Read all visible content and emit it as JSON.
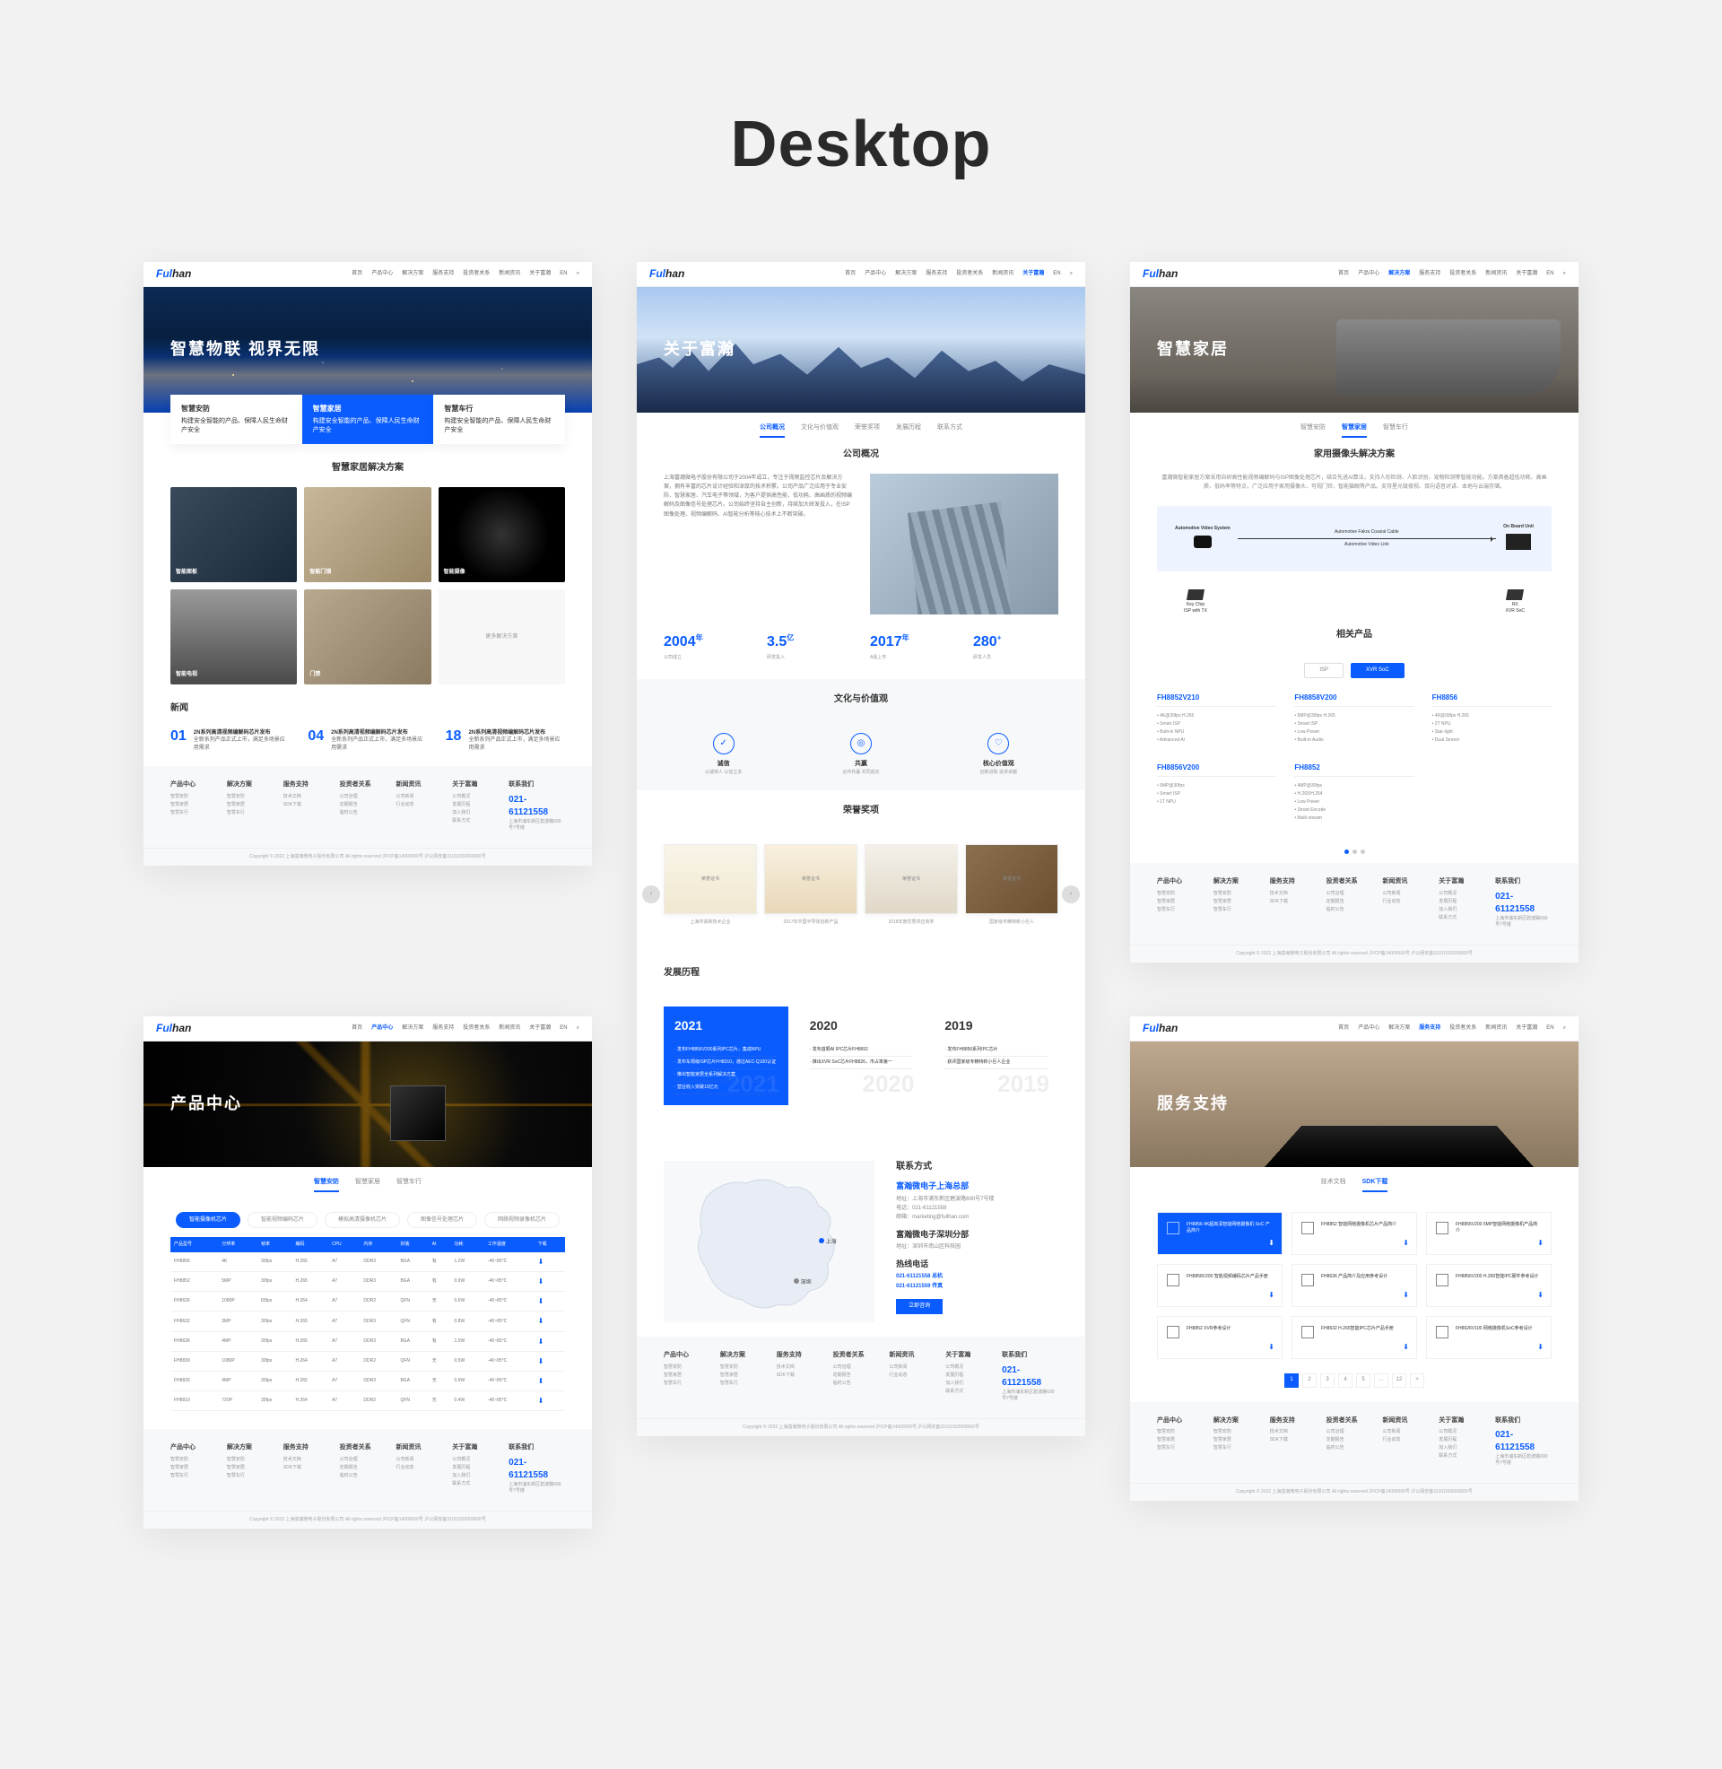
{
  "main_title": "Desktop",
  "brand": {
    "fu": "Ful",
    "han": "han"
  },
  "nav": {
    "items": [
      "首页",
      "产品中心",
      "解决方案",
      "服务支持",
      "投资者关系",
      "新闻资讯",
      "关于富瀚",
      "EN"
    ]
  },
  "footer": {
    "cols": [
      {
        "h": "产品中心",
        "items": [
          "智慧安防",
          "智慧家居",
          "智慧车行"
        ]
      },
      {
        "h": "解决方案",
        "items": [
          "智慧安防",
          "智慧家居",
          "智慧车行"
        ]
      },
      {
        "h": "服务支持",
        "items": [
          "技术文档",
          "SDK下载"
        ]
      },
      {
        "h": "投资者关系",
        "items": [
          "公司治理",
          "定期报告",
          "临时公告"
        ]
      },
      {
        "h": "新闻资讯",
        "items": [
          "公司新闻",
          "行业动态"
        ]
      },
      {
        "h": "关于富瀚",
        "items": [
          "公司概况",
          "发展历程",
          "加入我们",
          "联系方式"
        ]
      }
    ],
    "contact": {
      "h": "联系我们",
      "tel": "021-61121558",
      "addr": "上海市浦东新区碧波路690号7号楼"
    },
    "copy": "Copyright © 2022 上海富瀚微电子股份有限公司 All rights reserved   沪ICP备14000000号   沪公网安备31011502000000号"
  },
  "m1": {
    "hero": {
      "title": "智慧物联  视界无限"
    },
    "tabs": [
      {
        "t": "智慧安防",
        "d": "构建安全智能的产品、保障人民生命财产安全"
      },
      {
        "t": "智慧家居",
        "d": "构建安全智能的产品、保障人民生命财产安全"
      },
      {
        "t": "智慧车行",
        "d": "构建安全智能的产品、保障人民生命财产安全"
      }
    ],
    "section_title": "智慧家居解决方案",
    "thumbs": [
      "智能面板",
      "智能门锁",
      "智能摄像",
      "智能电视",
      "门禁",
      "更多解决方案"
    ],
    "news_title": "新闻",
    "news": [
      {
        "d": "01",
        "t": "2N系列高清视频编解码芯片发布",
        "s": "全新系列产品正式上市，满足多场景应用需求"
      },
      {
        "d": "04",
        "t": "2N系列高清视频编解码芯片发布",
        "s": "全新系列产品正式上市，满足多场景应用需求"
      },
      {
        "d": "18",
        "t": "2N系列高清视频编解码芯片发布",
        "s": "全新系列产品正式上市，满足多场景应用需求"
      }
    ]
  },
  "m2": {
    "hero": {
      "title": "关于富瀚"
    },
    "subnav": [
      "公司概况",
      "文化与价值观",
      "荣誉奖项",
      "发展历程",
      "联系方式"
    ],
    "overview": {
      "title": "公司概况",
      "body": "上海富瀚微电子股份有限公司于2004年成立，专注于视频监控芯片及解决方案，拥有丰富的芯片设计经验和深厚的技术积累。公司产品广泛应用于专业安防、智慧家居、汽车电子等领域，为客户提供高性能、低功耗、高画质的视频编解码及图像信号处理芯片。公司始终坚持自主创新，持续加大研发投入，在ISP图像处理、视频编解码、AI智能分析等核心技术上不断突破。"
    },
    "stats": [
      {
        "n": "2004",
        "l": "公司成立"
      },
      {
        "n": "3.5",
        "sup": "亿",
        "l": "研发投入"
      },
      {
        "n": "2017",
        "l": "A股上市"
      },
      {
        "n": "280",
        "sup": "+",
        "l": "研发人员"
      }
    ],
    "values": {
      "title": "文化与价值观",
      "items": [
        {
          "ic": "✓",
          "t": "诚信",
          "d": "以诚待人 以信立本"
        },
        {
          "ic": "◎",
          "t": "共赢",
          "d": "合作共赢 共同成长"
        },
        {
          "ic": "♡",
          "t": "核心价值观",
          "d": "创新进取 追求卓越"
        }
      ]
    },
    "awards": {
      "title": "荣誉奖项",
      "items": [
        "荣誉证书",
        "荣誉证书",
        "荣誉证书",
        "荣誉证书"
      ],
      "captions": [
        "上海市高新技术企业",
        "2017年中国半导体创新产品",
        "2018年度优秀供应商奖",
        "国家级专精特新小巨人"
      ]
    },
    "history": {
      "title": "发展历程",
      "years": [
        {
          "y": "2021",
          "items": [
            "发布FH8856V200系列IPC芯片，集成NPU",
            "发布车规级ISP芯片FH8310，通过AEC-Q100认证",
            "推出智能家居全系列解决方案",
            "营业收入突破10亿元"
          ]
        },
        {
          "y": "2020",
          "items": [
            "发布首颗AI IPC芯片FH8652",
            "推出XVR SoC芯片FH8826，市占率第一"
          ]
        },
        {
          "y": "2019",
          "items": [
            "发布FH8856系列IPC芯片",
            "获评国家级专精特新小巨人企业"
          ]
        }
      ]
    },
    "contact": {
      "title": "联系方式",
      "hq": {
        "h": "富瀚微电子上海总部",
        "lines": [
          "地址：上海市浦东新区碧波路690号7号楼",
          "电话：021-61121558",
          "邮箱：marketing@fullhan.com"
        ]
      },
      "branch": {
        "h": "富瀚微电子深圳分部",
        "lines": [
          "地址：深圳市南山区科技园"
        ]
      },
      "hotline": {
        "h": "热线电话",
        "tel1": "021-61121558 总机",
        "tel2": "021-61121559 传真"
      },
      "btn": "立即咨询",
      "pins": [
        {
          "label": "上海"
        },
        {
          "label": "深圳"
        }
      ]
    }
  },
  "m3": {
    "hero": {
      "title": "智慧家居"
    },
    "subnav": [
      "智慧安防",
      "智慧家居",
      "智慧车行"
    ],
    "sol_title": "家用摄像头解决方案",
    "sol_desc": "富瀚微智能家居方案采用自研高性能视频编解码与ISP图像处理芯片，结合先进AI算法，支持人形检测、人脸识别、宠物检测等智能功能。方案具备超低功耗、高画质、低码率等特点，广泛应用于家用摄像头、可视门铃、智能猫眼等产品。支持星光级夜视、双向语音对讲、本地与云端存储。",
    "diagram": {
      "left": "Automotive Video System",
      "cam": "Camera",
      "cable1": "Automotive Fakra Coaxial Cable",
      "cable2": "Automotive Video Link",
      "right": "On Board Unit",
      "chip_l": "Key Chip",
      "chip_l2": "ISP with TX",
      "chip_r": "RX",
      "chip_r2": "XVR SoC"
    },
    "rel_title": "相关产品",
    "prod_tabs": [
      "ISP",
      "XVR SoC"
    ],
    "products": [
      {
        "name": "FH8852V210",
        "specs": [
          "4K@30fps H.265",
          "Smart ISP",
          "Built-in NPU",
          "Advanced AI"
        ]
      },
      {
        "name": "FH8858V200",
        "specs": [
          "5MP@30fps H.265",
          "Smart ISP",
          "Low Power",
          "Built-in Audio"
        ]
      },
      {
        "name": "FH8856",
        "specs": [
          "4K@30fps H.265",
          "2T NPU",
          "Star-light",
          "Dual Sensor"
        ]
      },
      {
        "name": "FH8856V200",
        "specs": [
          "5MP@30fps",
          "Smart ISP",
          "1T NPU"
        ]
      },
      {
        "name": "FH8852",
        "specs": [
          "4MP@30fps",
          "H.265/H.264",
          "Low Power",
          "Smart Encode",
          "Multi-stream"
        ]
      }
    ]
  },
  "m4": {
    "hero": {
      "title": "产品中心"
    },
    "subnav": [
      "智慧安防",
      "智慧家居",
      "智慧车行"
    ],
    "pills": [
      "智能摄像机芯片",
      "智能视频编码芯片",
      "模拟高清摄像机芯片",
      "图像信号处理芯片",
      "网络视频录像机芯片"
    ],
    "table": {
      "headers": [
        "产品型号",
        "分辨率",
        "帧率",
        "编码",
        "CPU",
        "内存",
        "封装",
        "AI",
        "功耗",
        "工作温度",
        "下载"
      ],
      "rows": [
        [
          "FH8856",
          "4K",
          "30fps",
          "H.265",
          "A7",
          "DDR3",
          "BGA",
          "有",
          "1.2W",
          "-40~85°C",
          "↓"
        ],
        [
          "FH8852",
          "5MP",
          "30fps",
          "H.265",
          "A7",
          "DDR3",
          "BGA",
          "有",
          "0.9W",
          "-40~85°C",
          "↓"
        ],
        [
          "FH8626",
          "1080P",
          "60fps",
          "H.264",
          "A7",
          "DDR2",
          "QFN",
          "无",
          "0.6W",
          "-40~85°C",
          "↓"
        ],
        [
          "FH8632",
          "3MP",
          "30fps",
          "H.265",
          "A7",
          "DDR3",
          "QFN",
          "有",
          "0.8W",
          "-40~85°C",
          "↓"
        ],
        [
          "FH8636",
          "4MP",
          "30fps",
          "H.265",
          "A7",
          "DDR3",
          "BGA",
          "有",
          "1.0W",
          "-40~85°C",
          "↓"
        ],
        [
          "FH8830",
          "1080P",
          "30fps",
          "H.264",
          "A7",
          "DDR2",
          "QFN",
          "无",
          "0.5W",
          "-40~85°C",
          "↓"
        ],
        [
          "FH8826",
          "4MP",
          "30fps",
          "H.265",
          "A7",
          "DDR3",
          "BGA",
          "无",
          "0.9W",
          "-40~85°C",
          "↓"
        ],
        [
          "FH8810",
          "720P",
          "30fps",
          "H.264",
          "A7",
          "DDR2",
          "QFN",
          "无",
          "0.4W",
          "-40~85°C",
          "↓"
        ]
      ]
    }
  },
  "m5": {
    "hero": {
      "title": "服务支持"
    },
    "subnav": [
      "技术文档",
      "SDK下载"
    ],
    "downloads": [
      "FH8856 4K超高清智能网络摄像机 SoC 产品简介",
      "FH8852 智能网络摄像机芯片产品简介",
      "FH8856V200 5MP智能网络摄像机产品简介",
      "FH8858V200 智能视频编码芯片产品手册",
      "FH8636 产品简介及应用参考设计",
      "FH8856V200 H.265智能IPC硬件参考设计",
      "FH8852 XVR参考设计",
      "FH8632 H.265智能IPC芯片产品手册",
      "FH8626V100 网络摄像机SoC参考设计"
    ],
    "pager": [
      "1",
      "2",
      "3",
      "4",
      "5",
      "…",
      "12",
      ">"
    ]
  }
}
